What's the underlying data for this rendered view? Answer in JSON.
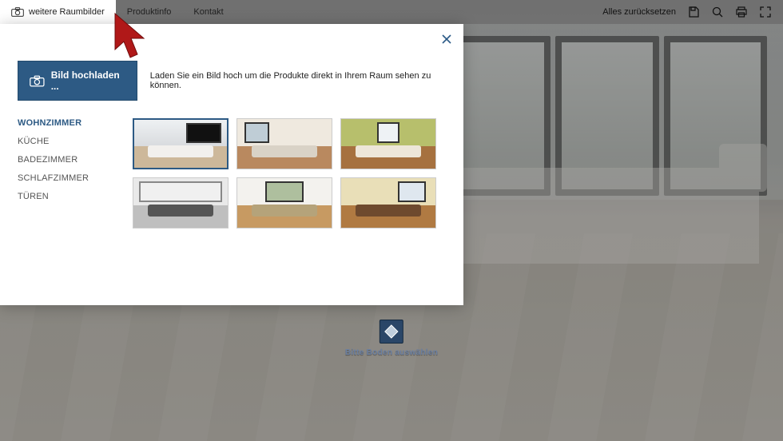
{
  "toolbar": {
    "tab_rooms": "weitere Raumbilder",
    "tab_productinfo": "Produktinfo",
    "tab_contact": "Kontakt",
    "reset": "Alles zurücksetzen",
    "icons": {
      "save": "save-icon",
      "zoom": "zoom-icon",
      "print": "print-icon",
      "fullscreen": "fullscreen-icon"
    }
  },
  "modal": {
    "upload_button": "Bild hochladen ...",
    "upload_caption": "Laden Sie ein Bild hoch um die Produkte direkt in Ihrem Raum sehen zu können.",
    "categories": [
      {
        "label": "WOHNZIMMER",
        "active": true
      },
      {
        "label": "KÜCHE",
        "active": false
      },
      {
        "label": "BADEZIMMER",
        "active": false
      },
      {
        "label": "SCHLAFZIMMER",
        "active": false
      },
      {
        "label": "TÜREN",
        "active": false
      }
    ],
    "thumbnails": [
      "room-1",
      "room-2",
      "room-3",
      "room-4",
      "room-5",
      "room-6"
    ],
    "selected_thumbnail_index": 0
  },
  "floor_selector": {
    "label": "Bitte Boden auswählen"
  },
  "colors": {
    "primary": "#2d5a84"
  }
}
